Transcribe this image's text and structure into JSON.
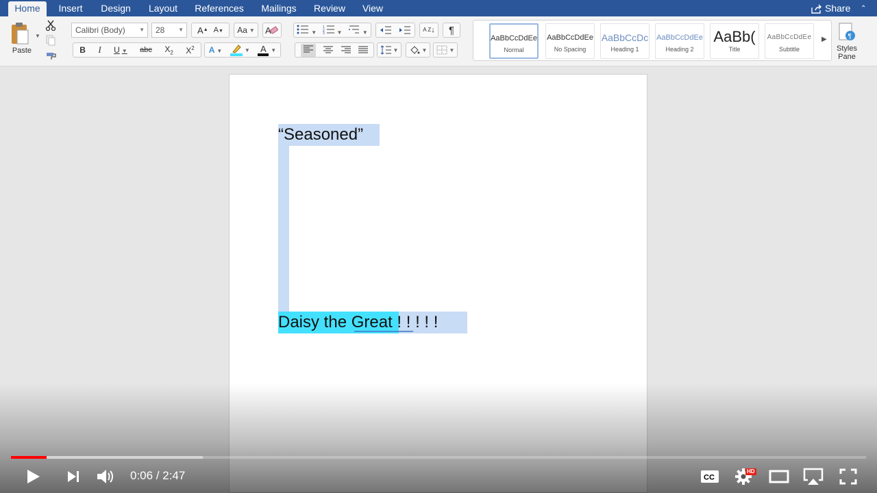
{
  "tabs": [
    {
      "label": "Home",
      "active": true
    },
    {
      "label": "Insert"
    },
    {
      "label": "Design"
    },
    {
      "label": "Layout"
    },
    {
      "label": "References"
    },
    {
      "label": "Mailings"
    },
    {
      "label": "Review"
    },
    {
      "label": "View"
    }
  ],
  "share_label": "Share",
  "clipboard": {
    "paste_label": "Paste"
  },
  "font": {
    "name": "Calibri (Body)",
    "size": "28"
  },
  "format_buttons": {
    "bold": "B",
    "italic": "I",
    "underline": "U",
    "strikethrough": "abc",
    "subscript": "X",
    "subscript_mark": "2",
    "superscript": "X",
    "superscript_mark": "2",
    "grow_font": "A",
    "shrink_font": "A",
    "change_case": "Aa",
    "sort": "A Z",
    "pilcrow": "¶",
    "text_effects": "A",
    "font_color": "A"
  },
  "styles": [
    {
      "preview": "AaBbCcDdEe",
      "label": "Normal",
      "selected": true
    },
    {
      "preview": "AaBbCcDdEe",
      "label": "No Spacing"
    },
    {
      "preview": "AaBbCcDc",
      "label": "Heading 1"
    },
    {
      "preview": "AaBbCcDdEe",
      "label": "Heading 2"
    },
    {
      "preview": "AaBb(",
      "label": "Title"
    },
    {
      "preview": "AaBbCcDdEe",
      "label": "Subtitle"
    }
  ],
  "styles_pane_label": [
    "Styles",
    "Pane"
  ],
  "document": {
    "line1": "“Seasoned”",
    "line2": "Daisy the Great  ! ! ! ! !"
  },
  "colors": {
    "ribbon_tab_bar": "#2b579a",
    "text_highlight": "#44e1ff",
    "selection": "#c9dcf5",
    "progress_played": "#ff0000"
  },
  "player": {
    "current_time": "0:06",
    "duration": "2:47",
    "time_display": "0:06 / 2:47",
    "played_fraction": 0.042,
    "loaded_fraction": 0.224,
    "hd_badge": "HD",
    "cc_label": "CC"
  }
}
